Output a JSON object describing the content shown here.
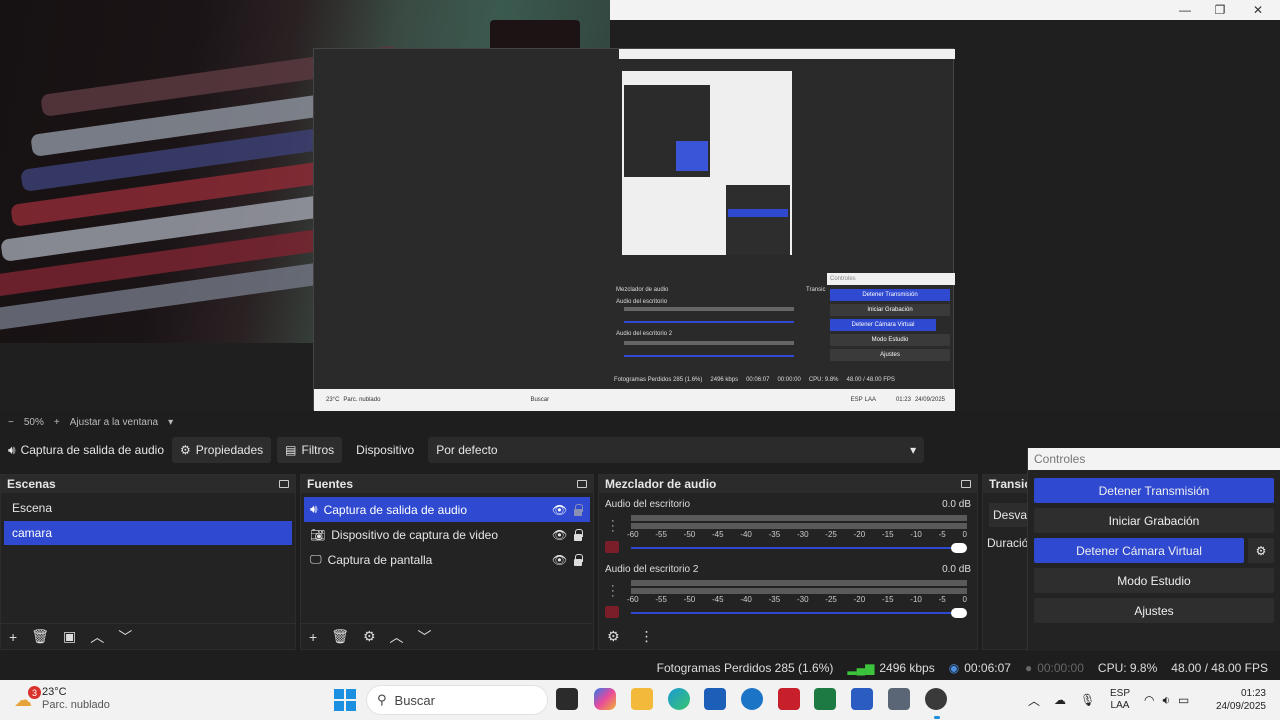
{
  "preview": {
    "nested_bottom": {
      "mixer_title": "Mezclador de audio",
      "transitions_short": "Transic",
      "controls_title": "Controles",
      "ch1": "Audio del escritorio",
      "ch2": "Audio del escritorio 2",
      "btn_stop_stream": "Detener Transmisión",
      "btn_start_rec": "Iniciar Grabación",
      "btn_stop_vcam": "Detener Cámara Virtual",
      "btn_studio": "Modo Estudio",
      "btn_settings": "Ajustes",
      "status": "Fotogramas Perdidos 285 (1.6%)",
      "kbps": "2496 kbps",
      "time": "00:06:07",
      "rec_time": "00:00:00",
      "cpu": "CPU: 9.8%",
      "fps": "48.00 / 48.00 FPS",
      "taskbar_temp": "23°C",
      "taskbar_weather": "Parc. nublado",
      "taskbar_search": "Buscar",
      "lang1": "ESP",
      "lang2": "LAA",
      "clock_time": "01:23",
      "clock_date": "24/09/2025"
    }
  },
  "zoom": {
    "minus": "−",
    "value": "50%",
    "plus": "+",
    "fit": "Ajustar a la ventana"
  },
  "propbar": {
    "source_name": "Captura de salida de audio",
    "properties": "Propiedades",
    "filters": "Filtros",
    "device_label": "Dispositivo",
    "device_value": "Por defecto"
  },
  "scenes": {
    "title": "Escenas",
    "items": [
      "Escena",
      "camara"
    ]
  },
  "sources": {
    "title": "Fuentes",
    "items": [
      "Captura de salida de audio",
      "Dispositivo de captura de video",
      "Captura de pantalla"
    ]
  },
  "mixer": {
    "title": "Mezclador de audio",
    "channels": [
      {
        "name": "Audio del escritorio",
        "db": "0.0 dB"
      },
      {
        "name": "Audio del escritorio 2",
        "db": "0.0 dB"
      }
    ],
    "scale": [
      "-60",
      "-55",
      "-50",
      "-45",
      "-40",
      "-35",
      "-30",
      "-25",
      "-20",
      "-15",
      "-10",
      "-5",
      "0"
    ]
  },
  "transitions": {
    "title": "Transic",
    "fade": "Desvan",
    "duration": "Duración"
  },
  "controls": {
    "title": "Controles",
    "stop_stream": "Detener Transmisión",
    "start_record": "Iniciar Grabación",
    "stop_vcam": "Detener Cámara Virtual",
    "studio_mode": "Modo Estudio",
    "settings": "Ajustes"
  },
  "status": {
    "dropped": "Fotogramas Perdidos 285 (1.6%)",
    "bitrate": "2496 kbps",
    "stream_time": "00:06:07",
    "rec_time": "00:00:00",
    "cpu": "CPU: 9.8%",
    "fps": "48.00 / 48.00 FPS"
  },
  "taskbar": {
    "weather_badge": "3",
    "temp": "23°C",
    "weather": "Parc. nublado",
    "search": "Buscar",
    "lang1": "ESP",
    "lang2": "LAA",
    "time": "01:23",
    "date": "24/09/2025"
  },
  "colors": {
    "accent": "#2f4ad0",
    "mute": "#7a1e2a",
    "bg": "#1e1e1e",
    "panel": "#232323"
  }
}
